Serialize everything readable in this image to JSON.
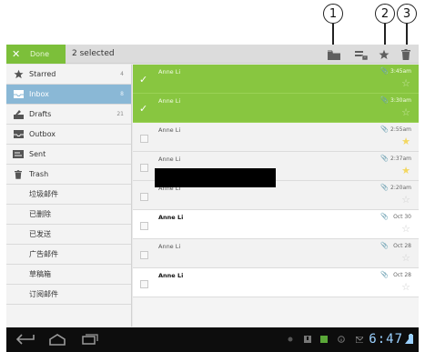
{
  "callouts": [
    "1",
    "2",
    "3"
  ],
  "action_bar": {
    "close_glyph": "✕",
    "done_label": "Done",
    "selection_count": "2 selected",
    "actions": [
      {
        "name": "move-to-folder",
        "icon": "folder-icon"
      },
      {
        "name": "change-labels",
        "icon": "labels-icon"
      },
      {
        "name": "add-star",
        "icon": "star-icon"
      },
      {
        "name": "delete",
        "icon": "trash-icon"
      }
    ]
  },
  "sidebar": {
    "items": [
      {
        "label": "Starred",
        "count": "4",
        "icon": "star-icon",
        "selected": false
      },
      {
        "label": "Inbox",
        "count": "8",
        "icon": "inbox-icon",
        "selected": true
      },
      {
        "label": "Drafts",
        "count": "21",
        "icon": "drafts-icon",
        "selected": false
      },
      {
        "label": "Outbox",
        "count": "",
        "icon": "outbox-icon",
        "selected": false
      },
      {
        "label": "Sent",
        "count": "",
        "icon": "sent-icon",
        "selected": false
      },
      {
        "label": "Trash",
        "count": "",
        "icon": "trash-icon",
        "selected": false
      },
      {
        "label": "垃圾邮件",
        "count": "",
        "icon": "",
        "selected": false
      },
      {
        "label": "已删除",
        "count": "",
        "icon": "",
        "selected": false
      },
      {
        "label": "已发送",
        "count": "",
        "icon": "",
        "selected": false
      },
      {
        "label": "广告邮件",
        "count": "",
        "icon": "",
        "selected": false
      },
      {
        "label": "草稿箱",
        "count": "",
        "icon": "",
        "selected": false
      },
      {
        "label": "订阅邮件",
        "count": "",
        "icon": "",
        "selected": false
      }
    ]
  },
  "messages": [
    {
      "sender": "Anne Li",
      "time": "3:45am",
      "selected": true,
      "unread": false,
      "attachment": true,
      "starred": false
    },
    {
      "sender": "Anne Li",
      "time": "3:30am",
      "selected": true,
      "unread": false,
      "attachment": true,
      "starred": false
    },
    {
      "sender": "Anne Li",
      "time": "2:55am",
      "selected": false,
      "unread": false,
      "attachment": true,
      "starred": true
    },
    {
      "sender": "Anne Li",
      "time": "2:37am",
      "selected": false,
      "unread": false,
      "attachment": true,
      "starred": true
    },
    {
      "sender": "Anne Li",
      "time": "2:20am",
      "selected": false,
      "unread": false,
      "attachment": true,
      "starred": false
    },
    {
      "sender": "Anne Li",
      "time": "Oct 30",
      "selected": false,
      "unread": true,
      "attachment": true,
      "starred": false
    },
    {
      "sender": "Anne Li",
      "time": "Oct 28",
      "selected": false,
      "unread": false,
      "attachment": true,
      "starred": false
    },
    {
      "sender": "Anne Li",
      "time": "Oct 28",
      "selected": false,
      "unread": true,
      "attachment": true,
      "starred": false
    }
  ],
  "system_bar": {
    "clock": "6:47",
    "nav_icons": [
      "back-icon",
      "home-icon",
      "recent-apps-icon"
    ],
    "status_icons": [
      "notification-dot-icon",
      "download-icon",
      "image-icon",
      "info-icon",
      "mail-icon",
      "signal-icon"
    ]
  },
  "colors": {
    "accent_green": "#88c640",
    "inbox_blue": "#8ab8d6",
    "clock_blue": "#9bd1ff",
    "star_yellow": "#f3d760"
  }
}
